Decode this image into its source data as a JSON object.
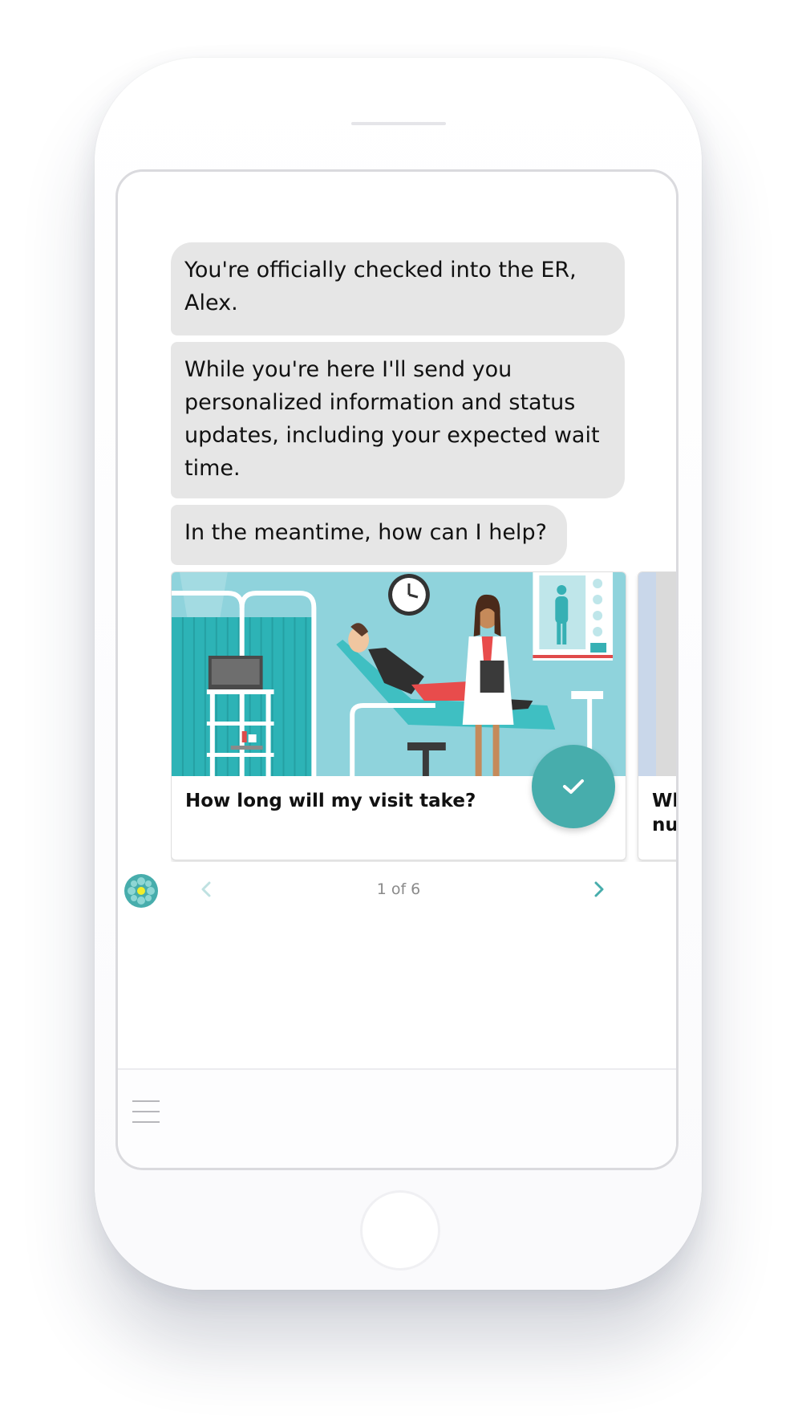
{
  "chat": {
    "messages": [
      {
        "text": "You're officially checked into the ER, Alex."
      },
      {
        "text": "While you're here I'll send you personalized information and status updates, including your expected wait time."
      },
      {
        "text": "In the meantime, how can I help?"
      }
    ]
  },
  "carousel": {
    "cards": [
      {
        "title": "How long will my visit take?",
        "image": "doctor-patient-exam-room-illustration"
      },
      {
        "title": "Wh\nnu",
        "image": "partial-card-illustration"
      }
    ],
    "pager": "1 of 6",
    "select_icon": "checkmark-icon",
    "prev_icon": "chevron-left-icon",
    "next_icon": "chevron-right-icon"
  },
  "bot": {
    "avatar_icon": "bot-avatar-icon"
  },
  "input_bar": {
    "menu_icon": "hamburger-menu-icon"
  },
  "colors": {
    "accent": "#47adac",
    "bubble": "#e6e6e6",
    "illustration_background": "#8fd3dc"
  }
}
